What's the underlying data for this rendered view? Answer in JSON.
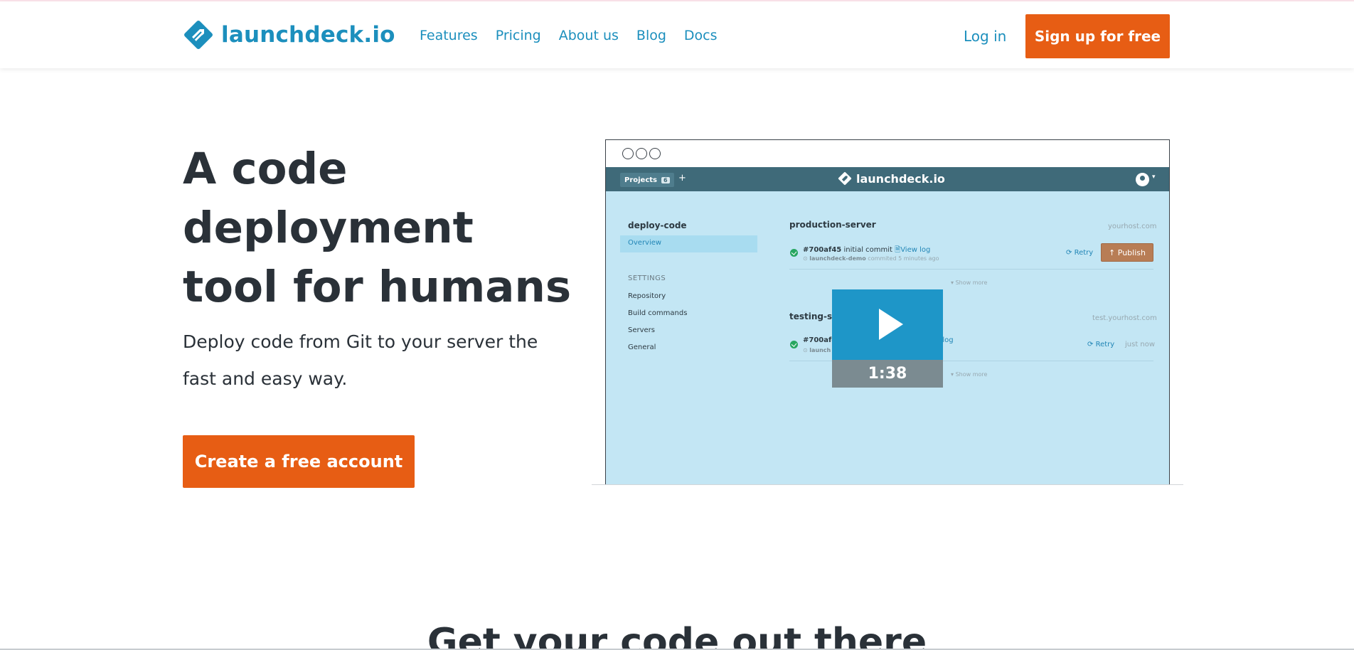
{
  "header": {
    "logo_text": "launchdeck.io",
    "nav": [
      "Features",
      "Pricing",
      "About us",
      "Blog",
      "Docs"
    ],
    "login_label": "Log in",
    "signup_label": "Sign up for free"
  },
  "hero": {
    "title": "A code deployment tool for humans",
    "subtitle": "Deploy code from Git to your server the fast and easy way.",
    "cta_label": "Create a free account"
  },
  "mockup": {
    "projects_label": "Projects",
    "projects_count": "6",
    "plus": "+",
    "logo_text": "launchdeck.io",
    "sidebar": {
      "project": "deploy-code",
      "overview": "Overview",
      "settings_heading": "SETTINGS",
      "links": [
        "Repository",
        "Build commands",
        "Servers",
        "General"
      ]
    },
    "servers": [
      {
        "name": "production-server",
        "host": "yourhost.com",
        "commit_id": "#700af45",
        "commit_msg": "initial commit",
        "view_log": "View log",
        "author": "launchdeck-demo",
        "meta": "commited 5 minutes ago",
        "retry": "Retry",
        "publish": "Publish",
        "show_more": "Show more"
      },
      {
        "name": "testing-server",
        "host": "test.yourhost.com",
        "commit_id": "#700af45",
        "view_log": "View log",
        "author": "launch",
        "retry": "Retry",
        "time": "just now",
        "show_more": "Show more"
      }
    ]
  },
  "video": {
    "duration": "1:38"
  },
  "section": {
    "title": "Get your code out there"
  },
  "colors": {
    "brand": "#1c8fbd",
    "accent": "#e75d14",
    "mock_bar": "#3f6a79",
    "mock_bg": "#c3e6f4"
  }
}
